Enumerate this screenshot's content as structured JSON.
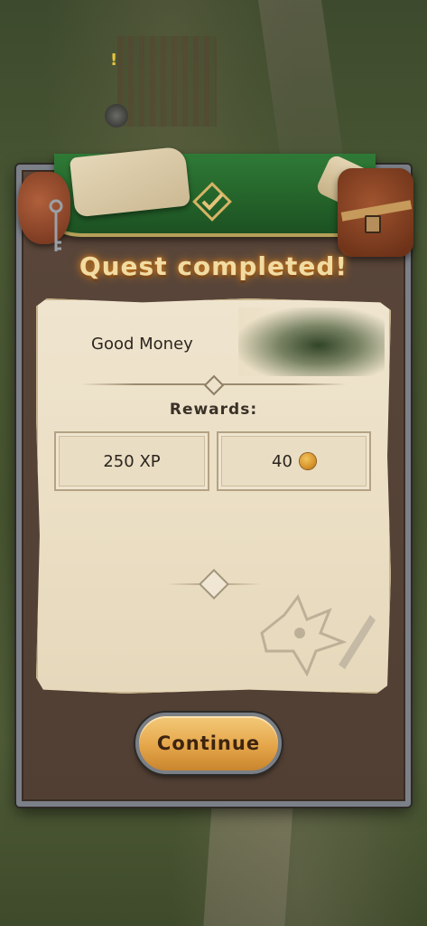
{
  "dialog": {
    "title": "Quest completed!",
    "quest_name": "Good Money",
    "rewards_label": "Rewards:",
    "rewards": [
      {
        "label": "250 XP"
      },
      {
        "label": "40",
        "icon": "coin-icon"
      }
    ],
    "continue_label": "Continue"
  },
  "colors": {
    "banner_green": "#236129",
    "title_glow": "#d78a2a",
    "button_gold": "#e5a64a",
    "panel_brown": "#513f33"
  }
}
